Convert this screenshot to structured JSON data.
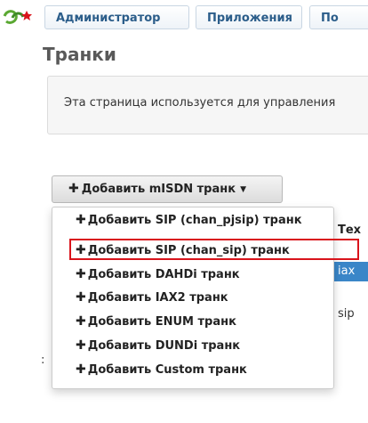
{
  "nav": {
    "items": [
      "Администратор",
      "Приложения",
      "По"
    ]
  },
  "page": {
    "title": "Транки",
    "info_text": "Эта страница используется для управления"
  },
  "add_button": {
    "label": "Добавить mISDN транк"
  },
  "dropdown": {
    "items": [
      "Добавить SIP (chan_pjsip) транк",
      "Добавить SIP (chan_sip) транк",
      "Добавить DAHDi транк",
      "Добавить IAX2 транк",
      "Добавить ENUM транк",
      "Добавить DUNDi транк",
      "Добавить Custom транк"
    ],
    "highlighted_index": 1,
    "highlight_color": "#d9141c"
  },
  "table_peek": {
    "column_header": "Тех",
    "row1": "iax",
    "row2": "sip",
    "selected_row_color": "#3a86c8"
  },
  "left_peek": ":"
}
